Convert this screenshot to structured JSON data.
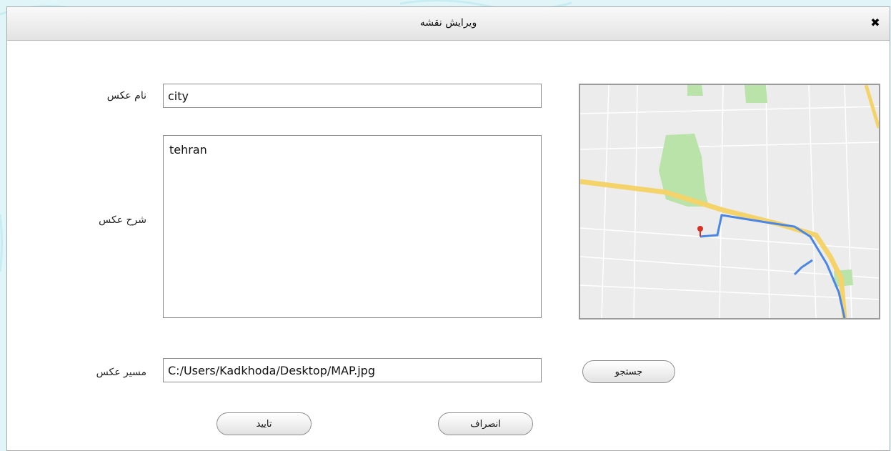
{
  "dialog": {
    "title": "ویرایش نقشه",
    "close_symbol": "✖"
  },
  "form": {
    "name_label": "نام عکس",
    "name_value": "city",
    "description_label": "شرح عکس",
    "description_value": "tehran",
    "path_label": "مسیر عکس",
    "path_value": "C:/Users/Kadkhoda/Desktop/MAP.jpg"
  },
  "buttons": {
    "browse": "جستجو",
    "cancel": "انصراف",
    "confirm": "تایید"
  },
  "map_preview": {
    "icon": "map-image",
    "colors": {
      "land": "#ececec",
      "park": "#b9e3a8",
      "highway": "#f5d36b",
      "route": "#4a86e8",
      "marker": "#d93025"
    }
  }
}
